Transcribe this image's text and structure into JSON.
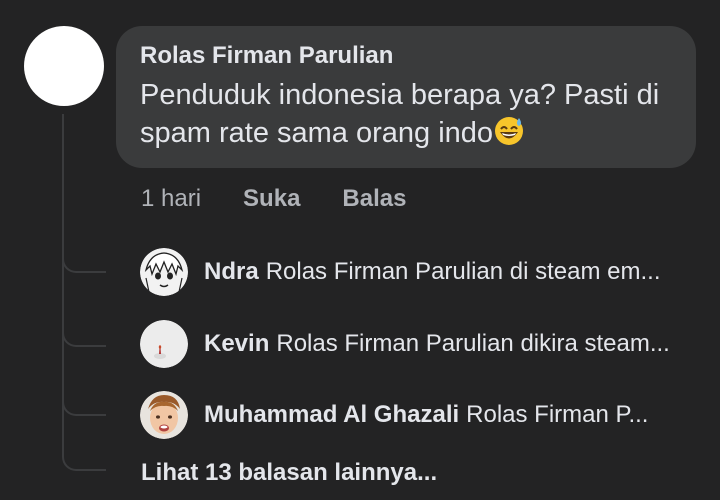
{
  "comment": {
    "author": "Rolas Firman Parulian",
    "text": "Penduduk indonesia berapa ya? Pasti di spam rate sama orang indo",
    "emoji_icon": "grinning-sweat-emoji",
    "time": "1 hari",
    "like_label": "Suka",
    "reply_label": "Balas"
  },
  "replies": [
    {
      "name": "Ndra",
      "snippet": "Rolas Firman Parulian di steam em...",
      "avatar_icon": "anime-drawing-avatar"
    },
    {
      "name": "Kevin",
      "snippet": "Rolas Firman Parulian dikira steam...",
      "avatar_icon": "light-gray-avatar"
    },
    {
      "name": "Muhammad Al Ghazali",
      "snippet": "Rolas Firman P...",
      "avatar_icon": "child-photo-avatar"
    }
  ],
  "more_replies_label": "Lihat 13 balasan lainnya...",
  "colors": {
    "background": "#232324",
    "bubble": "#3a3b3c",
    "primary_text": "#e4e6eb",
    "secondary_text": "#b0b3b8",
    "thread_line": "#3b3c3e"
  }
}
